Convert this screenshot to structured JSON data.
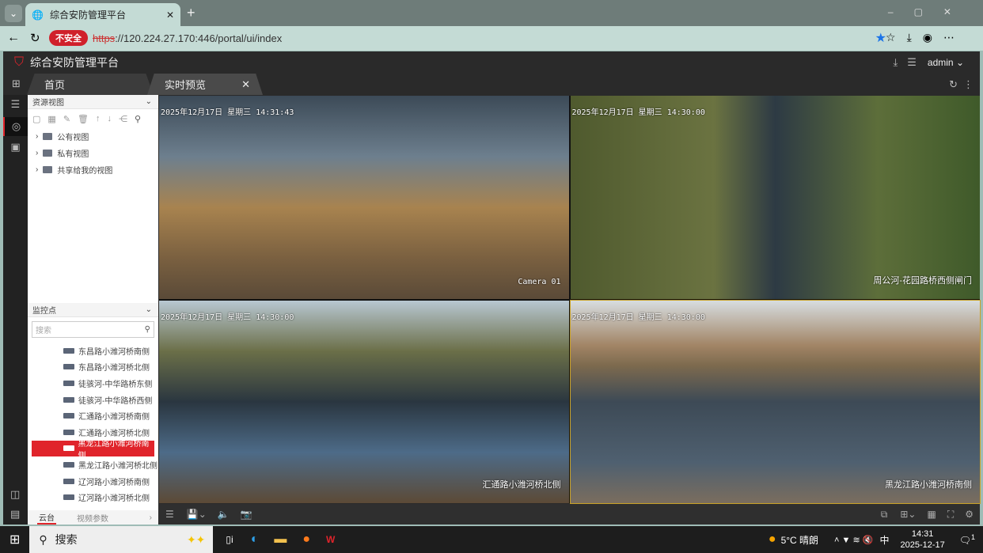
{
  "browser": {
    "tab_title": "综合安防管理平台",
    "security_label": "不安全",
    "url_scheme": "https",
    "url_rest": "://120.224.27.170:446/portal/ui/index"
  },
  "app": {
    "title": "综合安防管理平台",
    "user": "admin",
    "tabs": [
      {
        "label": "首页"
      },
      {
        "label": "实时预览"
      }
    ]
  },
  "panel": {
    "resource_title": "资源视图",
    "views": [
      "公有视图",
      "私有视图",
      "共享给我的视图"
    ],
    "monitor_title": "监控点",
    "search_placeholder": "搜索",
    "cameras": [
      "东昌路小潍河桥南侧",
      "东昌路小潍河桥北侧",
      "徒骇河-中华路桥东侧",
      "徒骇河-中华路桥西侧",
      "汇通路小潍河桥南侧",
      "汇通路小潍河桥北侧",
      "黑龙江路小潍河桥南侧",
      "黑龙江路小潍河桥北侧",
      "辽河路小潍河桥南侧",
      "辽河路小潍河桥北侧"
    ],
    "selected_index": 6,
    "bottom_tabs": [
      "云台",
      "视频参数"
    ]
  },
  "videos": [
    {
      "ts": "2025年12月17日 星期三 14:31:43",
      "name": "Camera 01"
    },
    {
      "ts": "2025年12月17日 星期三 14:30:00",
      "name": "周公河-花园路桥西侧闸门"
    },
    {
      "ts": "2025年12月17日 星期三 14:30:00",
      "name": "汇通路小潍河桥北侧"
    },
    {
      "ts": "2025年12月17日 星期三 14:30:00",
      "name": "黑龙江路小潍河桥南侧"
    }
  ],
  "taskbar": {
    "search": "搜索",
    "weather": "5°C 晴朗",
    "ime": "中",
    "time": "14:31",
    "date": "2025-12-17",
    "notifications": "1"
  }
}
